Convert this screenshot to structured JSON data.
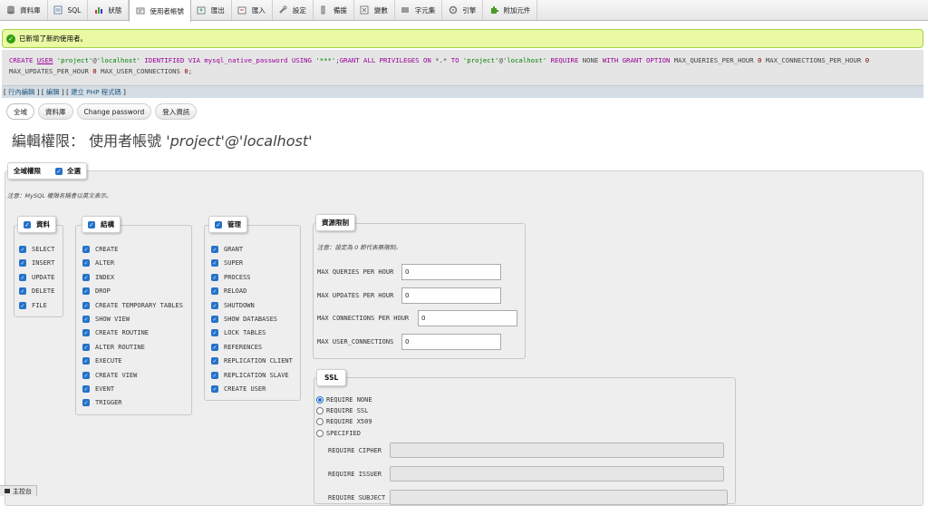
{
  "tabs": [
    {
      "label": "資料庫",
      "icon": "database-icon"
    },
    {
      "label": "SQL",
      "icon": "sql-icon"
    },
    {
      "label": "狀態",
      "icon": "status-chart-icon"
    },
    {
      "label": "使用者帳號",
      "icon": "users-icon"
    },
    {
      "label": "匯出",
      "icon": "export-icon"
    },
    {
      "label": "匯入",
      "icon": "import-icon"
    },
    {
      "label": "設定",
      "icon": "wrench-icon"
    },
    {
      "label": "備援",
      "icon": "replication-icon"
    },
    {
      "label": "變數",
      "icon": "variables-icon"
    },
    {
      "label": "字元集",
      "icon": "charset-icon"
    },
    {
      "label": "引擎",
      "icon": "engine-icon"
    },
    {
      "label": "附加元件",
      "icon": "plugin-icon"
    }
  ],
  "active_tab": "使用者帳號",
  "message": {
    "text": "已新增了新的使用者。",
    "icon": "success-check-icon"
  },
  "sql": {
    "line1_parts": [
      {
        "t": "CREATE ",
        "c": "kw"
      },
      {
        "t": "USER",
        "c": "kw u"
      },
      {
        "t": " ",
        "c": ""
      },
      {
        "t": "'project'",
        "c": "str"
      },
      {
        "t": "@",
        "c": ""
      },
      {
        "t": "'localhost'",
        "c": "str"
      },
      {
        "t": " IDENTIFIED VIA mysql_native_password USING ",
        "c": "kw"
      },
      {
        "t": "'***'",
        "c": "str"
      },
      {
        "t": ";",
        "c": ""
      },
      {
        "t": "GRANT ALL PRIVILEGES ON ",
        "c": "kw"
      },
      {
        "t": "*.* ",
        "c": ""
      },
      {
        "t": "TO ",
        "c": "kw"
      },
      {
        "t": "'project'",
        "c": "str"
      },
      {
        "t": "@",
        "c": ""
      },
      {
        "t": "'localhost'",
        "c": "str"
      },
      {
        "t": " REQUIRE ",
        "c": "kw"
      },
      {
        "t": "NONE ",
        "c": ""
      },
      {
        "t": "WITH GRANT OPTION ",
        "c": "kw"
      },
      {
        "t": "MAX_QUERIES_PER_HOUR ",
        "c": ""
      },
      {
        "t": "0",
        "c": "num"
      },
      {
        "t": " MAX_CONNECTIONS_PER_HOUR ",
        "c": ""
      },
      {
        "t": "0",
        "c": "num"
      }
    ],
    "line2_parts": [
      {
        "t": "MAX_UPDATES_PER_HOUR ",
        "c": ""
      },
      {
        "t": "0",
        "c": "num"
      },
      {
        "t": " MAX_USER_CONNECTIONS ",
        "c": ""
      },
      {
        "t": "0",
        "c": "num"
      },
      {
        "t": ";",
        "c": ""
      }
    ],
    "links": [
      "行內編輯",
      "編輯",
      "建立 PHP 程式碼"
    ]
  },
  "subtabs": [
    "全域",
    "資料庫",
    "Change password",
    "登入資訊"
  ],
  "title": {
    "prefix": "編輯權限： 使用者帳號 ",
    "user": "'project'@'localhost'"
  },
  "global": {
    "legend": "全域權限",
    "select_all": "全選",
    "note": "注意：MySQL 權限名稱會以英文表示。"
  },
  "groups": {
    "data": {
      "legend": "資料",
      "items": [
        "SELECT",
        "INSERT",
        "UPDATE",
        "DELETE",
        "FILE"
      ]
    },
    "structure": {
      "legend": "結構",
      "items": [
        "CREATE",
        "ALTER",
        "INDEX",
        "DROP",
        "CREATE TEMPORARY TABLES",
        "SHOW VIEW",
        "CREATE ROUTINE",
        "ALTER ROUTINE",
        "EXECUTE",
        "CREATE VIEW",
        "EVENT",
        "TRIGGER"
      ]
    },
    "admin": {
      "legend": "管理",
      "items": [
        "GRANT",
        "SUPER",
        "PROCESS",
        "RELOAD",
        "SHUTDOWN",
        "SHOW DATABASES",
        "LOCK TABLES",
        "REFERENCES",
        "REPLICATION CLIENT",
        "REPLICATION SLAVE",
        "CREATE USER"
      ]
    }
  },
  "limits": {
    "legend": "資源限制",
    "note": "注意：設定為 0 即代表無限制。",
    "fields": [
      {
        "label": "MAX QUERIES PER HOUR",
        "value": "0"
      },
      {
        "label": "MAX UPDATES PER HOUR",
        "value": "0"
      },
      {
        "label": "MAX CONNECTIONS PER HOUR",
        "value": "0"
      },
      {
        "label": "MAX USER_CONNECTIONS",
        "value": "0"
      }
    ]
  },
  "ssl": {
    "legend": "SSL",
    "options": [
      "REQUIRE NONE",
      "REQUIRE SSL",
      "REQUIRE X509",
      "SPECIFIED"
    ],
    "selected": "REQUIRE NONE",
    "fields": [
      "REQUIRE CIPHER",
      "REQUIRE ISSUER",
      "REQUIRE SUBJECT"
    ]
  },
  "console": {
    "label": "主控台"
  }
}
